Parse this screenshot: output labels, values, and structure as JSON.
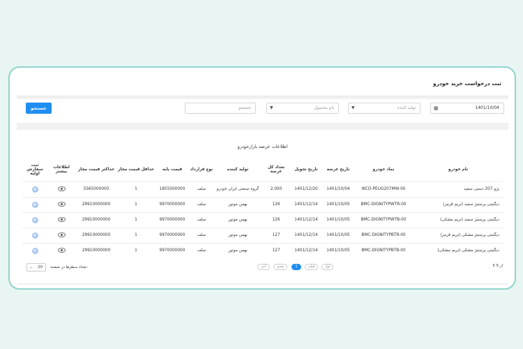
{
  "page_title": "ثبت درخواست خرید خودرو",
  "filters": {
    "search_button": "جستجو",
    "search_placeholder": "جستجو",
    "product_placeholder": "نام محصول",
    "producer_placeholder": "تولید کننده",
    "date_value": "1401/10/04"
  },
  "table": {
    "caption": "اطلاعات عرضه بازارخودرو",
    "headers": [
      "نام خودرو",
      "نماد خودرو",
      "تاریخ عرضه",
      "تاریخ تحویل",
      "تعداد کل عرضه",
      "تولید کننده",
      "نوع قرارداد",
      "قیمت پایه",
      "حداقل قیمت مجاز",
      "حداکثر قیمت مجاز",
      "اطلاعات بیشتر",
      "ثبت سفارش اولیه"
    ],
    "rows": [
      [
        "پژو 207 دستی سفید",
        "IKCO-PEUG207MW-00",
        "1401/10/04",
        "1401/12/20",
        "2,000",
        "گروه صنعتی ایران خودرو",
        "سلف",
        "1855000000",
        "1",
        "5565000000"
      ],
      [
        "دیگنیتی پرستیژ سفید (تریم قرمز)",
        "BMC-DIGNITYPWTR-00",
        "1401/10/05",
        "1401/12/14",
        "126",
        "بهمن موتور",
        "سلف",
        "9970000000",
        "1",
        "29910000000"
      ],
      [
        "دیگنیتی پرستیژ سفید (تریم مشکی)",
        "BMC-DIGNITYPWTB-00",
        "1401/10/05",
        "1401/12/14",
        "126",
        "بهمن موتور",
        "سلف",
        "9970000000",
        "1",
        "29910000000"
      ],
      [
        "دیگنیتی پرستیژ مشکی (تریم قرمز)",
        "BMC-DIGNITYPBTR-00",
        "1401/10/05",
        "1401/12/14",
        "127",
        "بهمن موتور",
        "سلف",
        "9970000000",
        "1",
        "29910000000"
      ],
      [
        "دیگنیتی پرستیژ مشکی (تریم مشکی)",
        "BMC-DIGNITYPBTB-00",
        "1401/10/05",
        "1401/12/14",
        "127",
        "بهمن موتور",
        "سلف",
        "9970000000",
        "1",
        "29910000000"
      ]
    ]
  },
  "pagination": {
    "page_count": "5 از 5",
    "first": "اول",
    "prev": "قبلی",
    "current": "1",
    "next": "بعدی",
    "last": "آخر",
    "rows_per_page_label": "تعداد سطرها در صفحه:",
    "rows_per_page_value": "20"
  },
  "colors": {
    "accent": "#1f8ef1",
    "frame": "#8fd3cc",
    "background": "#e9f5f3"
  },
  "icons": {
    "more_info": "eye-icon",
    "add_order": "plus-circle-icon",
    "date": "calendar-icon",
    "select": "chevron-down-icon"
  }
}
